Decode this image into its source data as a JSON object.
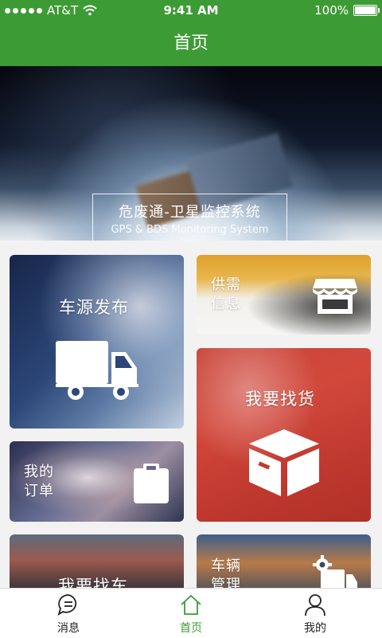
{
  "status_bar": {
    "carrier": "AT&T",
    "time": "9:41 AM",
    "battery": "100%"
  },
  "nav": {
    "title": "首页"
  },
  "banner": {
    "title": "危废通-卫星监控系统",
    "subtitle": "GPS & BDS Monitoring System"
  },
  "tiles": {
    "car_source": {
      "label": "车源发布",
      "icon": "truck-icon"
    },
    "supply": {
      "line1": "供需",
      "line2": "信息",
      "icon": "store-icon"
    },
    "find_goods": {
      "label": "我要找货",
      "icon": "box-icon"
    },
    "orders": {
      "line1": "我的",
      "line2": "订单",
      "icon": "clipboard-icon"
    },
    "find_car": {
      "label": "我要找车"
    },
    "vehicle_mgmt": {
      "line1": "车辆",
      "line2": "管理",
      "icon": "truck-gear-icon"
    }
  },
  "tabbar": {
    "items": [
      {
        "label": "消息",
        "icon": "chat-icon"
      },
      {
        "label": "首页",
        "icon": "home-icon"
      },
      {
        "label": "我的",
        "icon": "user-icon"
      }
    ],
    "active_color": "#3d9b35"
  },
  "colors": {
    "brand": "#3d9b35"
  }
}
